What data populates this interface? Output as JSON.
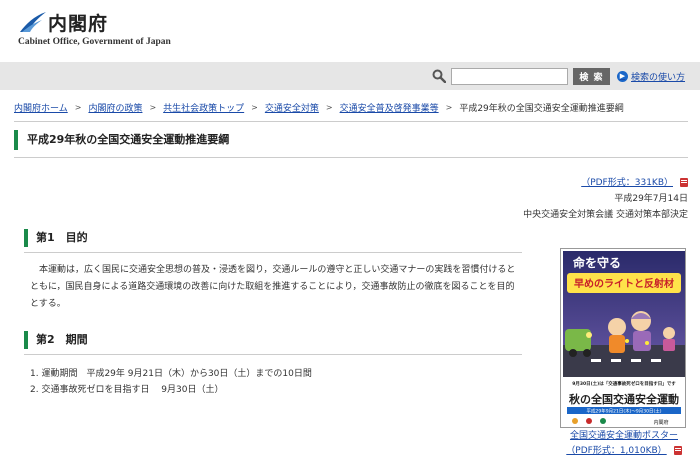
{
  "header": {
    "logo_title": "内閣府",
    "logo_subtitle": "Cabinet Office, Government of Japan"
  },
  "search": {
    "placeholder": "",
    "button_label": "検 索",
    "help_label": "検索の使い方"
  },
  "breadcrumb": {
    "items": [
      "内閣府ホーム",
      "内閣府の政策",
      "共生社会政策トップ",
      "交通安全対策",
      "交通安全普及啓発事業等"
    ],
    "current": "平成29年秋の全国交通安全運動推進要綱"
  },
  "page": {
    "title": "平成29年秋の全国交通安全運動推進要綱"
  },
  "meta": {
    "pdf_label": "（PDF形式：331KB）",
    "date": "平成29年7月14日",
    "issuer": "中央交通安全対策会議 交通対策本部決定"
  },
  "sections": {
    "s1_title": "第1　目的",
    "s1_body": "本運動は，広く国民に交通安全思想の普及・浸透を図り，交通ルールの遵守と正しい交通マナーの実践を習慣付けるとともに，国民自身による道路交通環境の改善に向けた取組を推進することにより，交通事故防止の徹底を図ることを目的とする。",
    "s2_title": "第2　期間",
    "s2_items": [
      "1. 運動期間　平成29年 9月21日（木）から30日（土）までの10日間",
      "2. 交通事故死ゼロを目指す日　 9月30日（土）"
    ]
  },
  "poster": {
    "headline1": "命を守る",
    "headline2": "早めのライトと反射材",
    "banner": "9月30日(土)は「交通事故死ゼロを目指す日」です",
    "main_title": "秋の全国交通安全運動",
    "dates": "平成29年9月21日(木)～9月30日(土)",
    "org": "内閣府",
    "caption_line1": "全国交通安全運動ポスター",
    "caption_line2": "（PDF形式：1,010KB）"
  }
}
